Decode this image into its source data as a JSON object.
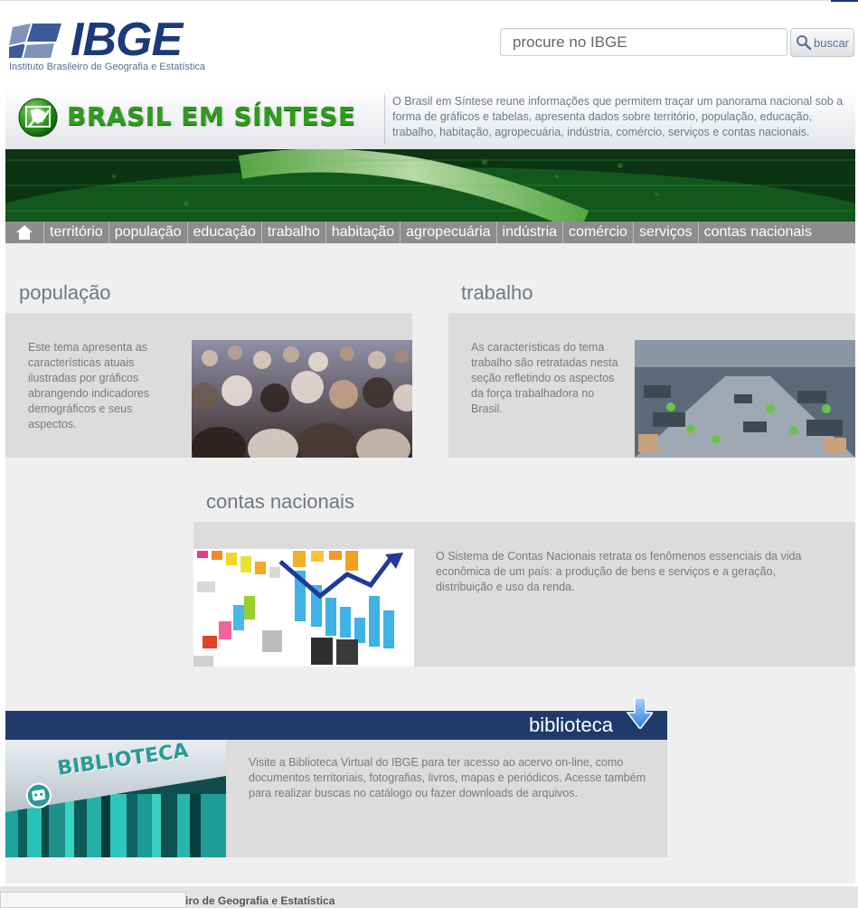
{
  "header": {
    "brand": "IBGE",
    "brand_subtitle": "Instituto Brasileiro de Geografia e Estatística",
    "search_placeholder": "procure no IBGE",
    "search_button": "buscar"
  },
  "banner": {
    "title": "BRASIL EM SÍNTESE",
    "description": "O Brasil em Síntese reune informações que permitem traçar um panorama nacional sob a forma de gráficos e tabelas, apresenta dados sobre território, população, educação, trabalho, habitação, agropecuária, indústria, comércio, serviços e contas nacionais."
  },
  "nav": {
    "items": [
      "território",
      "população",
      "educação",
      "trabalho",
      "habitação",
      "agropecuária",
      "indústria",
      "comércio",
      "serviços",
      "contas nacionais"
    ]
  },
  "sections": {
    "populacao": {
      "title": "população",
      "text": "Este tema apresenta as características atuais ilustradas por gráficos abrangendo indicadores demográficos e seus aspectos."
    },
    "trabalho": {
      "title": "trabalho",
      "text": "As características do tema trabalho são retratadas nesta seção refletindo os aspectos da força trabalhadora no Brasil."
    },
    "contas": {
      "title": "contas nacionais",
      "text": "O Sistema de Contas Nacionais retrata os fenômenos essenciais da vida econômica de um país: a produção de bens e serviços e a geração, distribuição e uso da renda."
    }
  },
  "biblioteca": {
    "heading": "biblioteca",
    "image_label": "BIBLIOTECA",
    "text": "Visite a Biblioteca Virtual do IBGE para ter acesso ao acervo on-line, como documentos territoriais, fotografias, livros, mapas e periódicos. Acesse também para realizar buscas no catálogo ou fazer downloads de arquivos."
  },
  "footer": {
    "text": "iro de Geografia e Estatística"
  },
  "colors": {
    "brand_blue": "#1d3a78",
    "banner_green": "#2f9c1e",
    "nav_gray": "#8d8d8d",
    "biblioteca_bar": "#1f3a6b"
  }
}
